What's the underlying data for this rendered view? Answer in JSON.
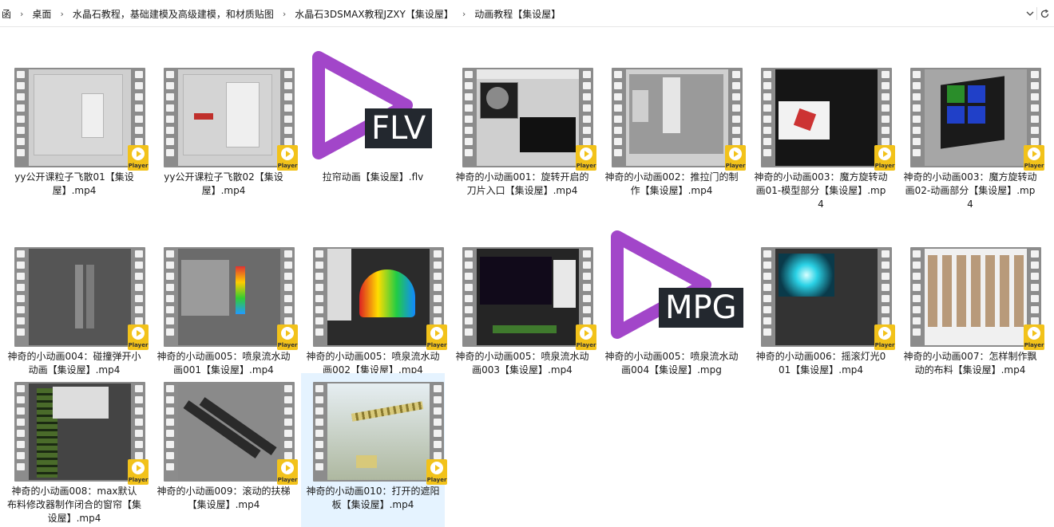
{
  "address": {
    "crumbs": [
      "函",
      "桌面",
      "水晶石教程，基础建模及高级建模，和材质贴图",
      "水晶石3DSMAX教程JZXY【集设屋】",
      "动画教程【集设屋】"
    ],
    "separator": "›",
    "dropdown_icon": "chevron-down-icon",
    "refresh_icon": "refresh-icon"
  },
  "badge_text": "Player",
  "files": [
    {
      "name": "yy公开课粒子飞散01【集设屋】.mp4",
      "type": "video",
      "selected": false
    },
    {
      "name": "yy公开课粒子飞散02【集设屋】.mp4",
      "type": "video",
      "selected": false
    },
    {
      "name": "拉帘动画【集设屋】.flv",
      "type": "flv",
      "ext_tag": "FLV",
      "selected": false
    },
    {
      "name": "神奇的小动画001：旋转开启的刀片入口【集设屋】.mp4",
      "type": "video",
      "selected": false
    },
    {
      "name": "神奇的小动画002：推拉门的制作【集设屋】.mp4",
      "type": "video",
      "selected": false
    },
    {
      "name": "神奇的小动画003：魔方旋转动画01-模型部分【集设屋】.mp4",
      "type": "video",
      "selected": false
    },
    {
      "name": "神奇的小动画003：魔方旋转动画02-动画部分【集设屋】.mp4",
      "type": "video",
      "selected": false
    },
    {
      "name": "神奇的小动画004：碰撞弹开小动画【集设屋】.mp4",
      "type": "video",
      "selected": false
    },
    {
      "name": "神奇的小动画005：喷泉流水动画001【集设屋】.mp4",
      "type": "video",
      "selected": false
    },
    {
      "name": "神奇的小动画005：喷泉流水动画002【集设屋】.mp4",
      "type": "video",
      "selected": false
    },
    {
      "name": "神奇的小动画005：喷泉流水动画003【集设屋】.mp4",
      "type": "video",
      "selected": false
    },
    {
      "name": "神奇的小动画005：喷泉流水动画004【集设屋】.mpg",
      "type": "mpg",
      "ext_tag": "MPG",
      "selected": false
    },
    {
      "name": "神奇的小动画006：摇滚灯光001【集设屋】.mp4",
      "type": "video",
      "selected": false
    },
    {
      "name": "神奇的小动画007：怎样制作飘动的布料【集设屋】.mp4",
      "type": "video",
      "selected": false
    },
    {
      "name": "神奇的小动画008：max默认布料修改器制作闭合的窗帘【集设屋】.mp4",
      "type": "video",
      "selected": false
    },
    {
      "name": "神奇的小动画009：滚动的扶梯【集设屋】.mp4",
      "type": "video",
      "selected": false
    },
    {
      "name": "神奇的小动画010：打开的遮阳板【集设屋】.mp4",
      "type": "video",
      "selected": true
    }
  ],
  "colors": {
    "play_icon": "#a246c9",
    "tag_bg": "#23282f",
    "badge": "#f2c21a",
    "selection": "#e5f3ff"
  }
}
